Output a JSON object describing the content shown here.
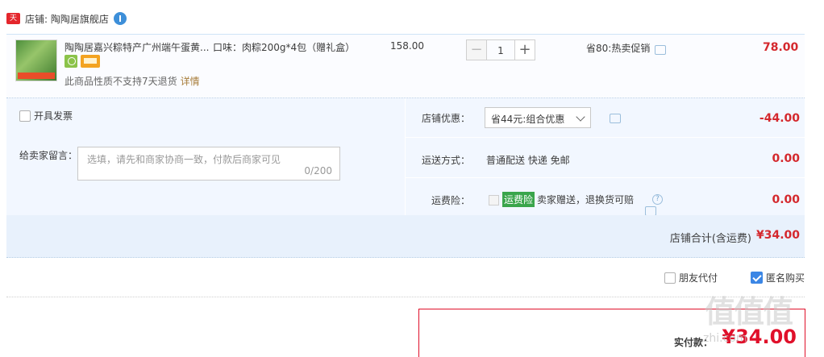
{
  "shop": {
    "badge": "天猫",
    "name": "店铺: 陶陶居旗舰店"
  },
  "item": {
    "title": "陶陶居嘉兴粽特产广州端午蛋黄...",
    "sku": "口味：肉粽200g*4包（赠礼盒）",
    "return_note": "此商品性质不支持7天退货",
    "return_link": "详情",
    "unit_price": "158.00",
    "quantity": "1",
    "minus": "−",
    "plus": "+",
    "promo": "省80:热卖促销",
    "total": "78.00"
  },
  "invoice": {
    "label": "开具发票"
  },
  "message": {
    "label": "给卖家留言：",
    "placeholder": "选填，请先和商家协商一致，付款后商家可见",
    "count": "0/200"
  },
  "discount": {
    "label": "店铺优惠：",
    "selected": "省44元:组合优惠",
    "amount": "-44.00"
  },
  "shipping": {
    "label": "运送方式：",
    "method": "普通配送 快递 免邮",
    "amount": "0.00"
  },
  "insurance": {
    "label": "运费险：",
    "tag": "运费险",
    "text": "卖家赠送，退换货可赔",
    "help": "?",
    "amount": "0.00"
  },
  "subtotal": {
    "label": "店铺合计(含运费)",
    "value": "¥34.00"
  },
  "options": {
    "friend_pay": "朋友代付",
    "anonymous": "匿名购买"
  },
  "payment": {
    "label": "实付款：",
    "value": "¥34.00"
  },
  "watermark": {
    "text": "值值值",
    "url": "zhi.com"
  },
  "colors": {
    "accent": "#d4282d",
    "panel": "#f2f7ff",
    "checkbox": "#3b86e5",
    "tag_green": "#3aa54b"
  }
}
